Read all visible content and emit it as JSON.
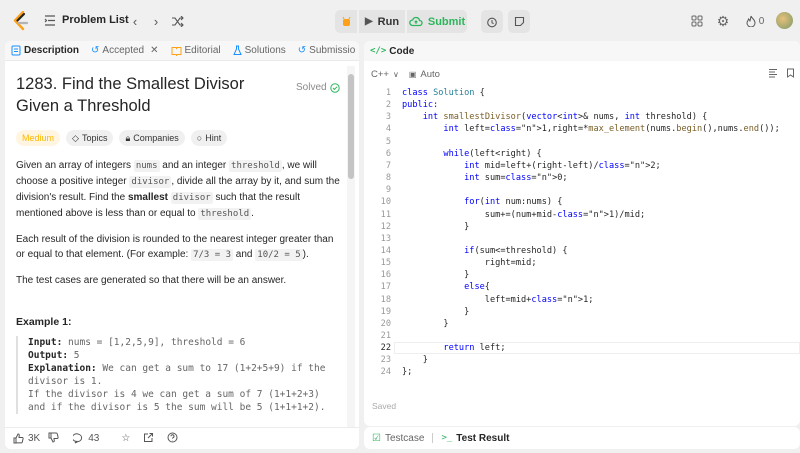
{
  "topbar": {
    "problem_list": "Problem List",
    "run": "Run",
    "submit": "Submit",
    "streak": "0"
  },
  "left_tabs": {
    "description": "Description",
    "accepted": "Accepted",
    "editorial": "Editorial",
    "solutions": "Solutions",
    "submissions": "Submissio"
  },
  "problem": {
    "title": "1283. Find the Smallest Divisor Given a Threshold",
    "status": "Solved",
    "difficulty": "Medium",
    "topics": "Topics",
    "companies": "Companies",
    "hint": "Hint"
  },
  "description": {
    "p1_a": "Given an array of integers ",
    "p1_nums": "nums",
    "p1_b": " and an integer ",
    "p1_threshold": "threshold",
    "p1_c": ", we will choose a positive integer ",
    "p1_divisor": "divisor",
    "p1_d": ", divide all the array by it, and sum the division's result. Find the ",
    "p1_smallest": "smallest",
    "p1_divisor2": "divisor",
    "p1_e": " such that the result mentioned above is less than or equal to ",
    "p1_threshold2": "threshold",
    "p1_f": ".",
    "p2_a": "Each result of the division is rounded to the nearest integer greater than or equal to that element. (For example: ",
    "p2_code1": "7/3 = 3",
    "p2_b": " and ",
    "p2_code2": "10/2 = 5",
    "p2_c": ").",
    "p3": "The test cases are generated so that there will be an answer."
  },
  "example": {
    "heading": "Example 1:",
    "input_label": "Input:",
    "input_value": " nums = [1,2,5,9], threshold = 6",
    "output_label": "Output:",
    "output_value": " 5",
    "explanation_label": "Explanation:",
    "explanation_value": " We can get a sum to 17 (1+2+5+9) if the",
    "line4": "divisor is 1.",
    "line5": "If the divisor is 4 we can get a sum of 7 (1+1+2+3)",
    "line6": "and if the divisor is 5 the sum will be 5 (1+1+1+2)."
  },
  "footer": {
    "likes": "3K",
    "comments": "43"
  },
  "editor": {
    "tab": "Code",
    "language": "C++",
    "mode": "Auto",
    "saved": "Saved",
    "line_numbers": [
      "1",
      "2",
      "3",
      "4",
      "5",
      "6",
      "7",
      "8",
      "9",
      "10",
      "11",
      "12",
      "13",
      "14",
      "15",
      "16",
      "17",
      "18",
      "19",
      "20",
      "21",
      "22",
      "23",
      "24"
    ],
    "lines": [
      "class Solution {",
      "public:",
      "    int smallestDivisor(vector<int>& nums, int threshold) {",
      "        int left=1,right=*max_element(nums.begin(),nums.end());",
      "",
      "        while(left<right) {",
      "            int mid=left+(right-left)/2;",
      "            int sum=0;",
      "",
      "            for(int num:nums) {",
      "                sum+=(num+mid-1)/mid;",
      "            }",
      "",
      "            if(sum<=threshold) {",
      "                right=mid;",
      "            }",
      "            else{",
      "                left=mid+1;",
      "            }",
      "        }",
      "",
      "        return left;",
      "    }",
      "};"
    ]
  },
  "bottom_tabs": {
    "testcase": "Testcase",
    "test_result": "Test Result"
  },
  "colors": {
    "accent_green": "#2db55d",
    "medium": "#ffb800",
    "keyword": "#0000ff",
    "number": "#098658"
  }
}
